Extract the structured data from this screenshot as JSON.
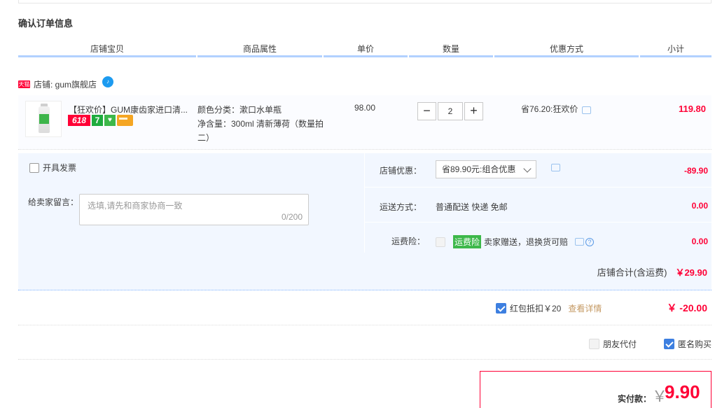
{
  "section_title": "确认订单信息",
  "columns": [
    "店铺宝贝",
    "商品属性",
    "单价",
    "数量",
    "优惠方式",
    "小计"
  ],
  "shop": {
    "badge": "天猫",
    "label": "店铺: gum旗舰店"
  },
  "item": {
    "title": "【狂欢价】GUM康齿家进口清...",
    "badges": [
      "618",
      "7"
    ],
    "attr_color": "颜色分类：漱口水单瓶",
    "attr_volume": "净含量：300ml 清新薄荷（数量拍二）",
    "unit_price": "98.00",
    "quantity": "2",
    "promotion": "省76.20:狂欢价",
    "subtotal": "119.80"
  },
  "invoice_label": "开具发票",
  "message": {
    "label": "给卖家留言：",
    "placeholder": "选填,请先和商家协商一致",
    "counter": "0/200"
  },
  "store_discount": {
    "label": "店铺优惠：",
    "selected": "省89.90元:组合优惠",
    "amount": "-89.90"
  },
  "shipping": {
    "label": "运送方式：",
    "value": "普通配送 快递 免邮",
    "amount": "0.00"
  },
  "insurance": {
    "label": "运费险：",
    "badge": "运费险",
    "text": "卖家赠送，退换货可赔",
    "amount": "0.00"
  },
  "store_total": {
    "label": "店铺合计(含运费)",
    "amount": "￥29.90"
  },
  "red_packet": {
    "label": "红包抵扣￥20",
    "link": "查看详情",
    "amount": "￥ -20.00"
  },
  "friend_pay_label": "朋友代付",
  "anonymous_label": "匿名购买",
  "payment": {
    "label": "实付款：",
    "currency": "￥",
    "amount": "9.90"
  },
  "colors": {
    "accent_red": "#ff0036",
    "header_underline": "#b2d1ff",
    "option_bg": "#f2f7ff",
    "checkbox_blue": "#3d7fe0"
  }
}
